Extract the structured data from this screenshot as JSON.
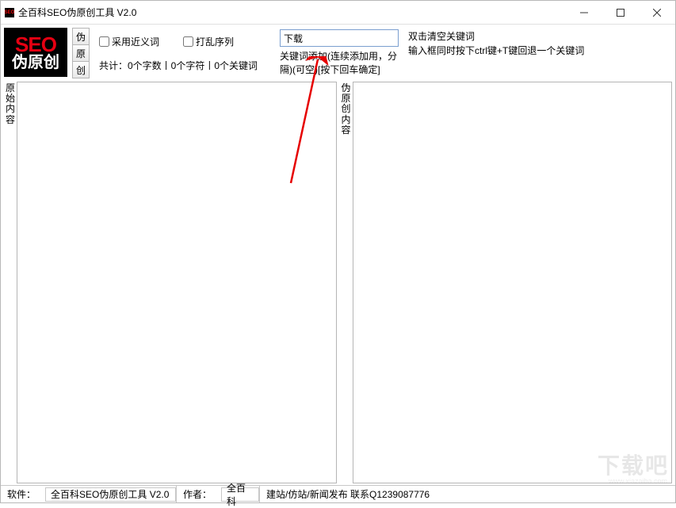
{
  "window": {
    "title": "全百科SEO伪原创工具 V2.0"
  },
  "logo": {
    "top": "SEO",
    "bottom": "伪原创"
  },
  "vertButtons": {
    "b1": "伪",
    "b2": "原",
    "b3": "创"
  },
  "options": {
    "useSynonym": "采用近义词",
    "shuffle": "打乱序列"
  },
  "stats": "共计：0个字数丨0个字符丨0个关键词",
  "keyword": {
    "value": "下载",
    "hint": "关键词添加(连续添加用，分隔)(可空)[按下回车确定]"
  },
  "tips": {
    "line1": "双击清空关键词",
    "line2": "输入框同时按下ctrl键+T键回退一个关键词"
  },
  "panels": {
    "left": "原始内容",
    "right": "伪原创内容"
  },
  "statusbar": {
    "softLabel": "软件：",
    "softName": "全百科SEO伪原创工具 V2.0",
    "authorLabel": "作者：",
    "authorName": "全百科",
    "link": "建站/仿站/新闻发布 联系Q1239087776"
  },
  "watermark": {
    "main": "下载吧",
    "sub": "www.xiazaiba.com"
  }
}
